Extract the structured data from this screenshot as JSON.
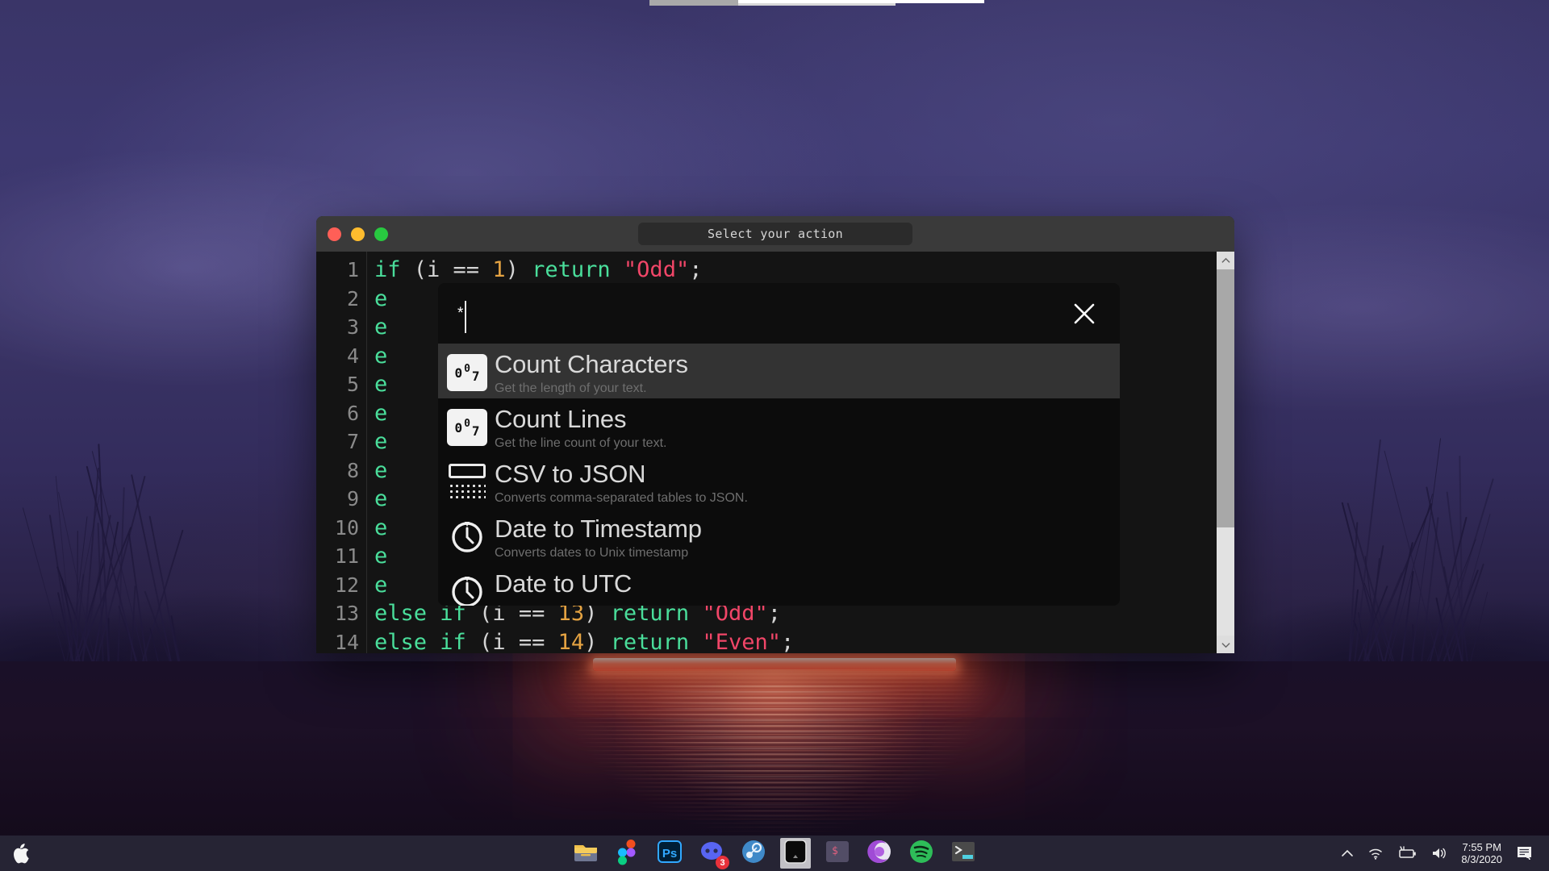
{
  "desktop": {
    "wallpaper_name": "night-lake-neon-wallpaper",
    "colors": {
      "sky": "#3a3568",
      "water": "#1a1028",
      "neon": "#ff7a5c"
    }
  },
  "window": {
    "title": "Select your action",
    "traffic_lights": [
      {
        "name": "close-traffic-light",
        "color": "#ff5f57"
      },
      {
        "name": "minimize-traffic-light",
        "color": "#febc2e"
      },
      {
        "name": "maximize-traffic-light",
        "color": "#28c840"
      }
    ]
  },
  "editor": {
    "line_numbers": [
      "1",
      "2",
      "3",
      "4",
      "5",
      "6",
      "7",
      "8",
      "9",
      "10",
      "11",
      "12",
      "13",
      "14"
    ],
    "lines": [
      {
        "n": "1",
        "tokens": [
          {
            "t": "if",
            "c": "kw"
          },
          {
            "t": " (",
            "c": "pun"
          },
          {
            "t": "i",
            "c": "pun"
          },
          {
            "t": " == ",
            "c": "pun"
          },
          {
            "t": "1",
            "c": "num"
          },
          {
            "t": ") ",
            "c": "pun"
          },
          {
            "t": "return",
            "c": "kw"
          },
          {
            "t": " ",
            "c": "pun"
          },
          {
            "t": "\"Odd\"",
            "c": "str"
          },
          {
            "t": ";",
            "c": "pun"
          }
        ]
      },
      {
        "n": "2",
        "tokens": [
          {
            "t": "e",
            "c": "kw"
          }
        ]
      },
      {
        "n": "3",
        "tokens": [
          {
            "t": "e",
            "c": "kw"
          }
        ]
      },
      {
        "n": "4",
        "tokens": [
          {
            "t": "e",
            "c": "kw"
          }
        ]
      },
      {
        "n": "5",
        "tokens": [
          {
            "t": "e",
            "c": "kw"
          }
        ]
      },
      {
        "n": "6",
        "tokens": [
          {
            "t": "e",
            "c": "kw"
          }
        ]
      },
      {
        "n": "7",
        "tokens": [
          {
            "t": "e",
            "c": "kw"
          }
        ]
      },
      {
        "n": "8",
        "tokens": [
          {
            "t": "e",
            "c": "kw"
          }
        ]
      },
      {
        "n": "9",
        "tokens": [
          {
            "t": "e",
            "c": "kw"
          }
        ]
      },
      {
        "n": "10",
        "tokens": [
          {
            "t": "e",
            "c": "kw"
          }
        ]
      },
      {
        "n": "11",
        "tokens": [
          {
            "t": "e",
            "c": "kw"
          }
        ]
      },
      {
        "n": "12",
        "tokens": [
          {
            "t": "e",
            "c": "kw"
          }
        ]
      },
      {
        "n": "13",
        "tokens": [
          {
            "t": "else if",
            "c": "kw"
          },
          {
            "t": " (",
            "c": "pun"
          },
          {
            "t": "i",
            "c": "pun"
          },
          {
            "t": " == ",
            "c": "pun"
          },
          {
            "t": "13",
            "c": "num"
          },
          {
            "t": ") ",
            "c": "pun"
          },
          {
            "t": "return",
            "c": "kw"
          },
          {
            "t": " ",
            "c": "pun"
          },
          {
            "t": "\"Odd\"",
            "c": "str"
          },
          {
            "t": ";",
            "c": "pun"
          }
        ]
      },
      {
        "n": "14",
        "tokens": [
          {
            "t": "else if",
            "c": "kw"
          },
          {
            "t": " (",
            "c": "pun"
          },
          {
            "t": "i",
            "c": "pun"
          },
          {
            "t": " == ",
            "c": "pun"
          },
          {
            "t": "14",
            "c": "num"
          },
          {
            "t": ") ",
            "c": "pun"
          },
          {
            "t": "return",
            "c": "kw"
          },
          {
            "t": " ",
            "c": "pun"
          },
          {
            "t": "\"Even\"",
            "c": "str"
          },
          {
            "t": ";",
            "c": "pun"
          }
        ]
      }
    ],
    "syntax_colors": {
      "keyword": "#4ade9b",
      "number": "#e5a342",
      "string": "#f14668",
      "punctuation": "#d4d4d4"
    },
    "scrollbar": {
      "up_arrow": "chevron-up",
      "down_arrow": "chevron-down"
    }
  },
  "palette": {
    "search_value": "*",
    "search_placeholder": "",
    "close_label": "close",
    "results": [
      {
        "title": "Count Characters",
        "desc": "Get the length of your text.",
        "icon": "counter-007-icon",
        "selected": true,
        "counter": [
          "0",
          "0",
          "7"
        ]
      },
      {
        "title": "Count Lines",
        "desc": "Get the line count of your text.",
        "icon": "counter-007-icon",
        "selected": false,
        "counter": [
          "0",
          "0",
          "7"
        ]
      },
      {
        "title": "CSV to JSON",
        "desc": "Converts comma-separated tables to JSON.",
        "icon": "csv-table-icon",
        "selected": false
      },
      {
        "title": "Date to Timestamp",
        "desc": "Converts dates to Unix timestamp",
        "icon": "clock-icon",
        "selected": false
      },
      {
        "title": "Date to UTC",
        "desc": "",
        "icon": "clock-icon",
        "selected": false
      }
    ]
  },
  "taskbar": {
    "apple_logo": "apple-logo-icon",
    "dock": [
      {
        "name": "files-icon",
        "label": "Files"
      },
      {
        "name": "figma-icon",
        "label": "Figma"
      },
      {
        "name": "photoshop-icon",
        "label": "Ps"
      },
      {
        "name": "discord-icon",
        "label": "Discord",
        "badge": "3"
      },
      {
        "name": "steam-icon",
        "label": "Steam"
      },
      {
        "name": "app-dark-icon",
        "label": "Active App",
        "active": true
      },
      {
        "name": "terminal-prompt-icon",
        "label": "$"
      },
      {
        "name": "firefox-icon",
        "label": "Firefox"
      },
      {
        "name": "spotify-icon",
        "label": "Spotify"
      },
      {
        "name": "terminal-icon",
        "label": "Terminal"
      }
    ],
    "tray": {
      "show_hidden": "chevron-up-icon",
      "wifi": "wifi-icon",
      "battery": "battery-charging-icon",
      "volume": "speaker-icon",
      "time": "7:55 PM",
      "date": "8/3/2020",
      "notifications": "notifications-icon"
    }
  }
}
